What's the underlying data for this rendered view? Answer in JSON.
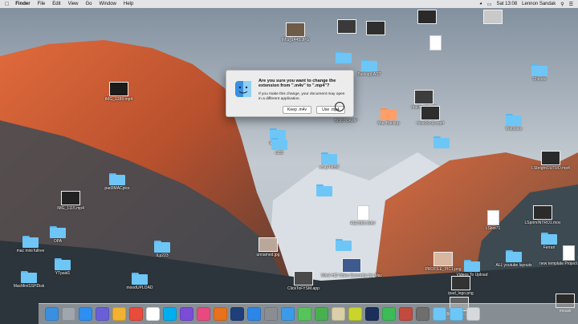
{
  "menubar": {
    "apple": "",
    "app": "Finder",
    "items": [
      "File",
      "Edit",
      "View",
      "Go",
      "Window",
      "Help"
    ],
    "clock": "Sat 13:08",
    "user": "Lennon Sandak"
  },
  "dialog": {
    "title": "Are you sure you want to change the extension from \".m4v\" to \".mp4\"?",
    "message": "If you make this change, your document may open in a different application.",
    "keep_label": "Keep .m4v",
    "use_label": "Use .mp4"
  },
  "desktop_icons": [
    {
      "label": "IMG_1445.JPG",
      "type": "thumb",
      "color": "#6e5c48"
    },
    {
      "label": "",
      "type": "thumb",
      "color": "#3a3a3a"
    },
    {
      "label": "",
      "type": "thumb",
      "color": "#2f2f2f"
    },
    {
      "label": "",
      "type": "thumb",
      "color": "#2a2a2a"
    },
    {
      "label": "",
      "type": "thumb",
      "color": "#c9c9c9"
    },
    {
      "label": "",
      "type": "doc",
      "color": "#ffffff"
    },
    {
      "label": "",
      "type": "folder",
      "color": "#6ec6f7"
    },
    {
      "label": "BackupLAST",
      "type": "folder",
      "color": "#6ec6f7"
    },
    {
      "label": "mucha AE CC",
      "type": "thumb",
      "color": "#3d3d3d"
    },
    {
      "label": "Chlorite",
      "type": "folder",
      "color": "#6ec6f7"
    },
    {
      "label": "IMG_1288.mp4",
      "type": "thumb",
      "color": "#1c1c1c"
    },
    {
      "label": "BOOTCAMP",
      "type": "folder",
      "color": "#6ec6f7"
    },
    {
      "label": "Mac Backup",
      "type": "folder",
      "color": "#f5a623"
    },
    {
      "label": "movi16-11.mp4",
      "type": "thumb",
      "color": "#2e2e2e"
    },
    {
      "label": "Websites",
      "type": "folder",
      "color": "#6ec6f7"
    },
    {
      "label": "leftOVER",
      "type": "folder",
      "color": "#6ec6f7"
    },
    {
      "label": "LCD",
      "type": "folder",
      "color": "#6ec6f7"
    },
    {
      "label": "eBayTab57",
      "type": "folder",
      "color": "#6ec6f7"
    },
    {
      "label": "",
      "type": "folder",
      "color": "#6ec6f7"
    },
    {
      "label": "LSbrightOUTRO.mp4",
      "type": "thumb",
      "color": "#2a2a2a"
    },
    {
      "label": "pad3MACpics",
      "type": "folder",
      "color": "#6ec6f7"
    },
    {
      "label": "",
      "type": "folder",
      "color": "#6ec6f7"
    },
    {
      "label": "IMG_1115.mp4",
      "type": "thumb",
      "color": "#222222"
    },
    {
      "label": "REC066.WAV",
      "type": "doc",
      "color": "#ffffff"
    },
    {
      "label": "LSbot71",
      "type": "doc",
      "color": "#ffffff"
    },
    {
      "label": "LSprimINTRO1.mov",
      "type": "thumb",
      "color": "#2b2b2b"
    },
    {
      "label": "OPA",
      "type": "folder",
      "color": "#6ec6f7"
    },
    {
      "label": "mac mini fullrev",
      "type": "folder",
      "color": "#6ec6f7"
    },
    {
      "label": "ILp223",
      "type": "folder",
      "color": "#6ec6f7"
    },
    {
      "label": "unnamed.jpg",
      "type": "thumb",
      "color": "#b9a89a"
    },
    {
      "label": "",
      "type": "folder",
      "color": "#6ec6f7"
    },
    {
      "label": "Ferrari",
      "type": "folder",
      "color": "#6ec6f7"
    },
    {
      "label": "YTpaid1",
      "type": "folder",
      "color": "#6ec6f7"
    },
    {
      "label": "WinX HD Video Converter for Mac",
      "type": "thumb",
      "color": "#3e5a8e"
    },
    {
      "label": "PROFILE_PIC1.png",
      "type": "thumb",
      "color": "#d9b6a0"
    },
    {
      "label": "ALL youtube layouts",
      "type": "folder",
      "color": "#6ec6f7"
    },
    {
      "label": "new template Project IMOV.mp4",
      "type": "doc",
      "color": "#ffffff"
    },
    {
      "label": "MacMiniSSHDisk",
      "type": "folder",
      "color": "#6ec6f7"
    },
    {
      "label": "moodUPLOAD",
      "type": "folder",
      "color": "#6ec6f7"
    },
    {
      "label": "ClickToFYSM.app",
      "type": "thumb",
      "color": "#4a4a4a"
    },
    {
      "label": "Videos To Upload",
      "type": "folder",
      "color": "#6ec6f7"
    },
    {
      "label": "ipad_logo.png",
      "type": "thumb",
      "color": "#333333"
    },
    {
      "label": "A562C476-...png",
      "type": "thumb",
      "color": "#5f5f5f"
    },
    {
      "label": "mousii",
      "type": "thumb",
      "color": "#2a2a2a"
    }
  ],
  "dock": {
    "apps": [
      {
        "name": "finder-icon",
        "color": "#3b8fe0"
      },
      {
        "name": "launchpad-icon",
        "color": "#a0a6ad"
      },
      {
        "name": "safari-icon",
        "color": "#2e8ff2"
      },
      {
        "name": "mission-control-icon",
        "color": "#6b5fd8"
      },
      {
        "name": "photos-icon",
        "color": "#f2b230"
      },
      {
        "name": "chrome-icon",
        "color": "#e94b3c"
      },
      {
        "name": "calendar-icon",
        "color": "#ffffff"
      },
      {
        "name": "skype-icon",
        "color": "#00aff0"
      },
      {
        "name": "imovie-icon",
        "color": "#7b4dd6"
      },
      {
        "name": "itunes-icon",
        "color": "#e84a7f"
      },
      {
        "name": "firefox-icon",
        "color": "#e8711d"
      },
      {
        "name": "photoshop-icon",
        "color": "#1f3f7a"
      },
      {
        "name": "app-store-icon",
        "color": "#2c86e8"
      },
      {
        "name": "settings-icon",
        "color": "#8a8d91"
      },
      {
        "name": "mail-icon",
        "color": "#3b9be8"
      },
      {
        "name": "messages-icon",
        "color": "#56c45a"
      },
      {
        "name": "facetime-icon",
        "color": "#48b04f"
      },
      {
        "name": "preview-icon",
        "color": "#d9d0a8"
      },
      {
        "name": "muse-icon",
        "color": "#c9d52b"
      },
      {
        "name": "lightroom-icon",
        "color": "#1c2f5a"
      },
      {
        "name": "spotify-icon",
        "color": "#3dbb57"
      },
      {
        "name": "misc-app-icon",
        "color": "#c24a3e"
      },
      {
        "name": "misc-app-2-icon",
        "color": "#6e6e6e"
      },
      {
        "name": "downloads-folder-icon",
        "color": "#6ec6f7"
      },
      {
        "name": "documents-icon",
        "color": "#6ec6f7"
      },
      {
        "name": "trash-icon",
        "color": "#d6d9dc"
      }
    ]
  }
}
